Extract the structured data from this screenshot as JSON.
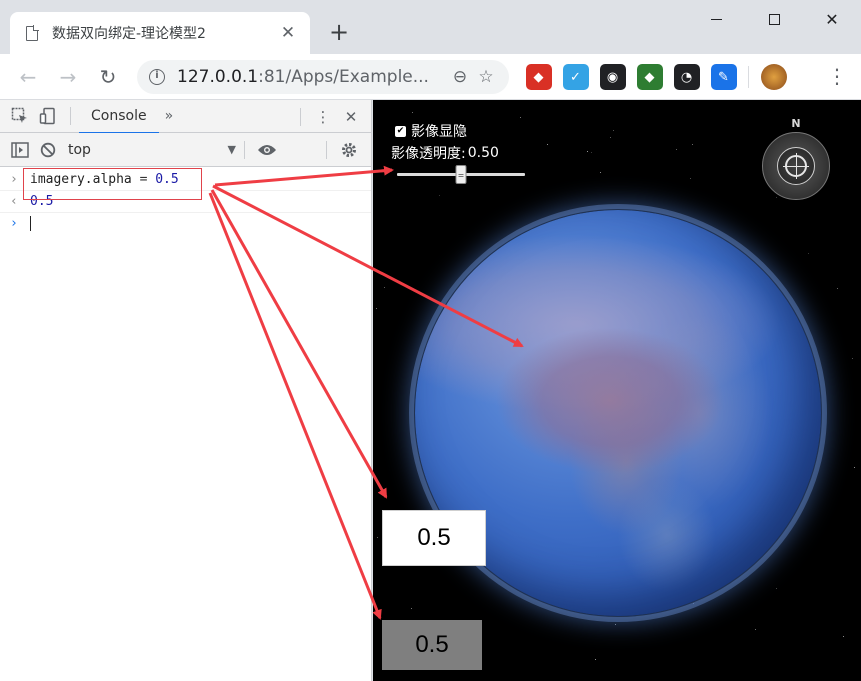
{
  "window": {
    "tab_title": "数据双向绑定-理论模型2",
    "tab_close": "✕",
    "new_tab": "+",
    "minimize": "",
    "maximize": "",
    "close": "✕"
  },
  "toolbar": {
    "back": "←",
    "forward": "→",
    "reload": "↻",
    "url_host": "127.0.0.1",
    "url_rest": ":81/Apps/Example...",
    "zoom_icon": "⊖",
    "star_icon": "☆",
    "menu": "⋮"
  },
  "extensions": [
    {
      "name": "ext-red",
      "color": "#d93025",
      "glyph": "◆"
    },
    {
      "name": "ext-vivaldi",
      "color": "#34a3e5",
      "glyph": "✓"
    },
    {
      "name": "ext-glasses",
      "color": "#202124",
      "glyph": "◉"
    },
    {
      "name": "ext-gem",
      "color": "#2e7d32",
      "glyph": "◆"
    },
    {
      "name": "ext-clock",
      "color": "#202124",
      "glyph": "◔"
    },
    {
      "name": "ext-edit",
      "color": "#1a73e8",
      "glyph": "✎"
    }
  ],
  "devtools": {
    "tab_console": "Console",
    "more_tabs": "»",
    "context": "top",
    "console": {
      "command_var": "imagery.alpha",
      "command_op": "=",
      "command_value": "0.5",
      "result": "0.5"
    }
  },
  "viewer": {
    "show_imagery_label": "影像显隐",
    "show_imagery_checked": true,
    "alpha_label": "影像透明度:",
    "alpha_value_text": "0.50",
    "alpha_fraction": 0.5,
    "compass_n": "N",
    "bound_input_value": "0.5",
    "bound_text_value": "0.5"
  },
  "colors": {
    "annotation_red": "#ef3d44",
    "accent_blue": "#1a73e8"
  }
}
